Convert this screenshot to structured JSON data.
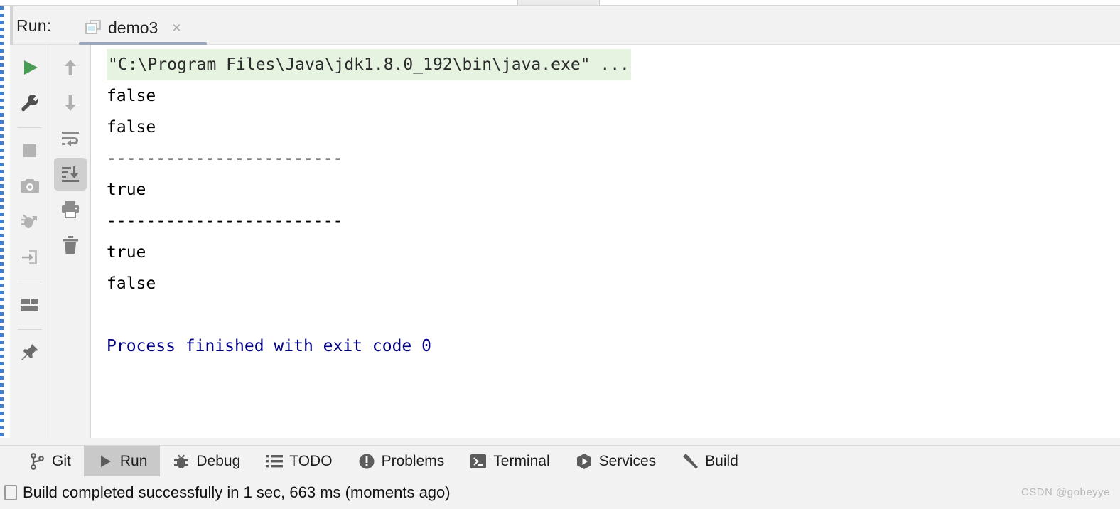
{
  "window": {
    "run_label": "Run:",
    "tab": {
      "title": "demo3",
      "icon": "run-configuration-icon",
      "close_icon": "×"
    }
  },
  "left_toolbar": {
    "items": [
      {
        "name": "rerun-button",
        "icon": "play-icon",
        "label": "Rerun"
      },
      {
        "name": "edit-configurations-button",
        "icon": "wrench-icon",
        "label": "Edit Configurations"
      },
      {
        "name": "stop-button",
        "icon": "stop-square-icon",
        "label": "Stop"
      },
      {
        "name": "screenshot-button",
        "icon": "camera-icon",
        "label": "Screenshot"
      },
      {
        "name": "attach-debugger-button",
        "icon": "bug-arrow-icon",
        "label": "Attach Debugger"
      },
      {
        "name": "import-button",
        "icon": "arrow-into-box-icon",
        "label": "Import"
      },
      {
        "name": "layout-button",
        "icon": "layout-grid-icon",
        "label": "Layout Settings"
      },
      {
        "name": "pin-tab-button",
        "icon": "pin-icon",
        "label": "Pin Tab"
      }
    ]
  },
  "console_toolbar": {
    "items": [
      {
        "name": "previous-occurrence-button",
        "icon": "arrow-up-icon",
        "label": "Up the Stack Trace"
      },
      {
        "name": "next-occurrence-button",
        "icon": "arrow-down-icon",
        "label": "Down the Stack Trace"
      },
      {
        "name": "soft-wrap-button",
        "icon": "soft-wrap-icon",
        "label": "Soft-Wrap",
        "active": false
      },
      {
        "name": "scroll-to-end-button",
        "icon": "scroll-to-end-icon",
        "label": "Scroll to End",
        "active": true
      },
      {
        "name": "print-button",
        "icon": "printer-icon",
        "label": "Print"
      },
      {
        "name": "clear-all-button",
        "icon": "trash-icon",
        "label": "Clear All"
      }
    ]
  },
  "console": {
    "lines": [
      {
        "text": "\"C:\\Program Files\\Java\\jdk1.8.0_192\\bin\\java.exe\" ...",
        "style": "cmd"
      },
      {
        "text": "false",
        "style": "out"
      },
      {
        "text": "false",
        "style": "out"
      },
      {
        "text": "------------------------",
        "style": "out"
      },
      {
        "text": "true",
        "style": "out"
      },
      {
        "text": "------------------------",
        "style": "out"
      },
      {
        "text": "true",
        "style": "out"
      },
      {
        "text": "false",
        "style": "out"
      },
      {
        "text": " ",
        "style": "blank"
      },
      {
        "text": "Process finished with exit code 0",
        "style": "exit"
      }
    ]
  },
  "bottom_tabs": [
    {
      "name": "bottom-tab-git",
      "label": "Git",
      "icon": "git-branch-icon",
      "active": false
    },
    {
      "name": "bottom-tab-run",
      "label": "Run",
      "icon": "play-triangle-icon",
      "active": true
    },
    {
      "name": "bottom-tab-debug",
      "label": "Debug",
      "icon": "bug-icon",
      "active": false
    },
    {
      "name": "bottom-tab-todo",
      "label": "TODO",
      "icon": "list-icon",
      "active": false
    },
    {
      "name": "bottom-tab-problems",
      "label": "Problems",
      "icon": "exclamation-circle-icon",
      "active": false
    },
    {
      "name": "bottom-tab-terminal",
      "label": "Terminal",
      "icon": "terminal-prompt-icon",
      "active": false
    },
    {
      "name": "bottom-tab-services",
      "label": "Services",
      "icon": "hexagon-play-icon",
      "active": false
    },
    {
      "name": "bottom-tab-build",
      "label": "Build",
      "icon": "hammer-icon",
      "active": false
    }
  ],
  "status_bar": {
    "message": "Build completed successfully in 1 sec, 663 ms (moments ago)",
    "icon": "notification-icon"
  },
  "watermark": "CSDN @gobeyye",
  "colors": {
    "console_command_bg": "#e6f3e1",
    "exit_text": "#000080",
    "run_green": "#499c54",
    "panel_bg": "#f2f2f2",
    "active_tab_bg": "#c9c9c9",
    "tab_underline": "#9aa7bd"
  }
}
